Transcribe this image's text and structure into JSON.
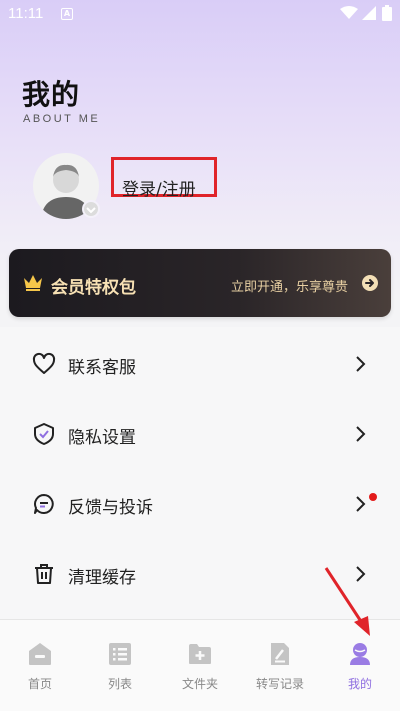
{
  "status_bar": {
    "time": "11:11",
    "notification_letter": "A"
  },
  "header": {
    "title": "我的",
    "subtitle": "ABOUT ME"
  },
  "profile": {
    "login_label": "登录/注册"
  },
  "vip": {
    "title": "会员特权包",
    "cta": "立即开通，乐享尊贵"
  },
  "menu": {
    "items": [
      {
        "label": "联系客服",
        "icon": "heart-icon"
      },
      {
        "label": "隐私设置",
        "icon": "shield-check-icon"
      },
      {
        "label": "反馈与投诉",
        "icon": "chat-bubble-icon",
        "badge": "red-dot"
      },
      {
        "label": "清理缓存",
        "icon": "trash-icon"
      }
    ]
  },
  "tabs": [
    {
      "label": "首页",
      "icon": "home-icon",
      "active": false
    },
    {
      "label": "列表",
      "icon": "list-icon",
      "active": false
    },
    {
      "label": "文件夹",
      "icon": "folder-add-icon",
      "active": false
    },
    {
      "label": "转写记录",
      "icon": "edit-document-icon",
      "active": false
    },
    {
      "label": "我的",
      "icon": "user-icon",
      "active": true
    }
  ],
  "colors": {
    "accent": "#8f6fe0",
    "vip_gold": "#f7e1b4",
    "annotation_red": "#e0242a",
    "badge_red": "#e31b1b"
  }
}
